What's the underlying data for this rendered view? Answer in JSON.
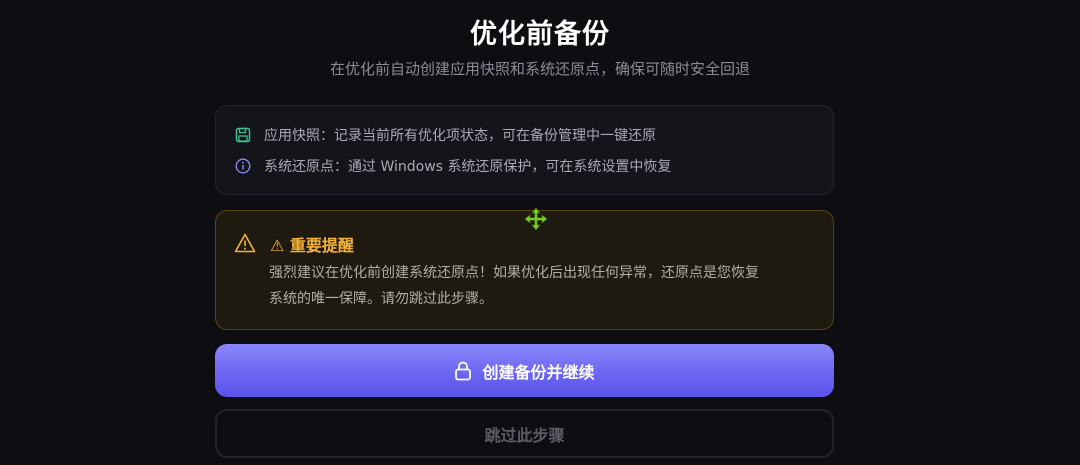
{
  "header": {
    "title": "优化前备份",
    "subtitle": "在优化前自动创建应用快照和系统还原点，确保可随时安全回退"
  },
  "info": {
    "items": [
      {
        "icon": "save-icon",
        "text": "应用快照：记录当前所有优化项状态，可在备份管理中一键还原"
      },
      {
        "icon": "info-icon",
        "text": "系统还原点：通过 Windows 系统还原保护，可在系统设置中恢复"
      }
    ]
  },
  "warning": {
    "title": "⚠ 重要提醒",
    "line1": "强烈建议在优化前创建系统还原点！如果优化后出现任何异常，还原点是您恢复",
    "line2": "系统的唯一保障。请勿跳过此步骤。"
  },
  "actions": {
    "primary_label": "创建备份并继续",
    "skip_label": "跳过此步骤"
  },
  "colors": {
    "accent": "#6c66f2",
    "warning": "#f5b335",
    "save_icon": "#3fbf8a",
    "info_icon": "#8b86f5"
  }
}
